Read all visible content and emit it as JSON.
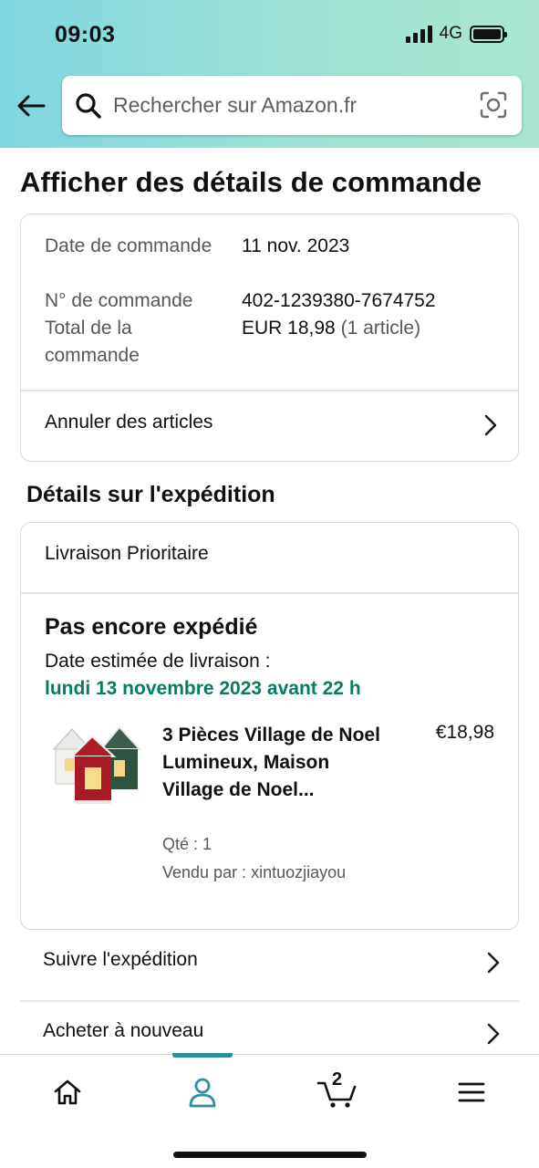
{
  "status_bar": {
    "time": "09:03",
    "network": "4G"
  },
  "search": {
    "placeholder": "Rechercher sur Amazon.fr"
  },
  "page": {
    "title": "Afficher des détails de commande"
  },
  "order_summary": {
    "date_label": "Date de commande",
    "date_value": "11 nov. 2023",
    "number_label": "N° de commande",
    "number_value": "402-1239380-7674752",
    "total_label": "Total de la commande",
    "total_value": "EUR 18,98",
    "total_items": "(1 article)",
    "cancel_link": "Annuler des articles"
  },
  "shipping": {
    "section_title": "Détails sur l'expédition",
    "method": "Livraison Prioritaire",
    "status": "Pas encore expédié",
    "eta_label": "Date estimée de livraison :",
    "eta_date": "lundi 13 novembre 2023 avant 22 h",
    "item": {
      "title": "3 Pièces Village de Noel Lumineux, Maison Village de Noel...",
      "price": "€18,98",
      "qty": "Qté : 1",
      "seller": "Vendu par : xintuozjiayou"
    }
  },
  "actions": {
    "track": "Suivre l'expédition",
    "buy_again": "Acheter à nouveau"
  },
  "bottom_nav": {
    "items": [
      "home-icon",
      "account-icon",
      "cart-icon",
      "menu-icon"
    ],
    "active": "account-icon",
    "cart_count": "2"
  },
  "colors": {
    "accent": "#2b8fa3",
    "delivery_green": "#067d62",
    "header_start": "#7fd6de",
    "header_end": "#a8e6cf"
  }
}
